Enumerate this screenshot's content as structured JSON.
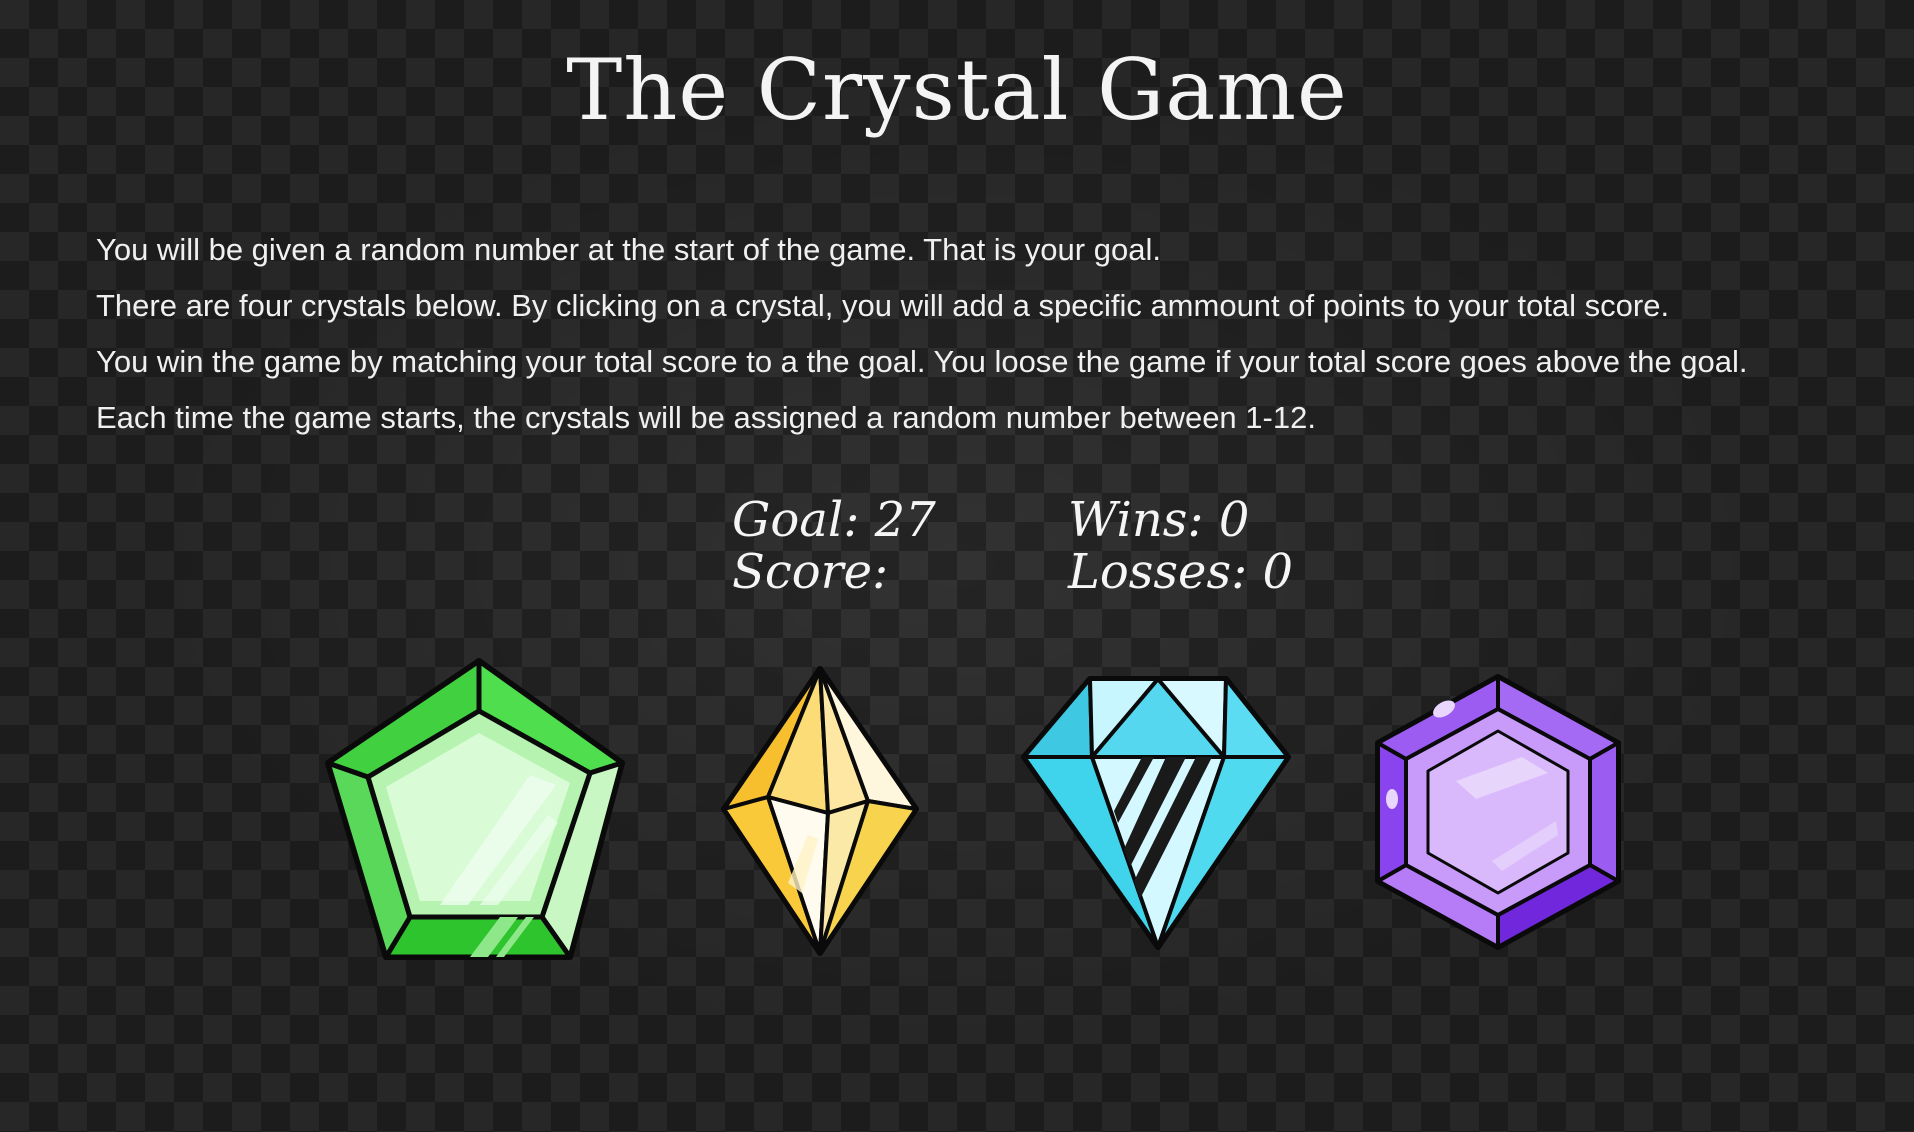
{
  "title": "The Crystal Game",
  "instructions": [
    "You will be given a random number at the start of the game. That is your goal.",
    "There are four crystals below. By clicking on a crystal, you will add a specific ammount of points to your total score.",
    "You win the game by matching your total score to a the goal. You loose the game if your total score goes above the goal.",
    "Each time the game starts, the crystals will be assigned a random number between 1-12."
  ],
  "stats": {
    "goal_label": "Goal:",
    "goal_value": "27",
    "score_label": "Score:",
    "score_value": "",
    "wins_label": "Wins:",
    "wins_value": "0",
    "losses_label": "Losses:",
    "losses_value": "0"
  },
  "crystals": [
    {
      "icon": "green-pentagon-crystal-icon",
      "color": "#3fd13f"
    },
    {
      "icon": "yellow-diamond-crystal-icon",
      "color": "#f6c945"
    },
    {
      "icon": "cyan-diamond-crystal-icon",
      "color": "#4fdaf0"
    },
    {
      "icon": "purple-hexagon-crystal-icon",
      "color": "#8a3ff0"
    }
  ]
}
